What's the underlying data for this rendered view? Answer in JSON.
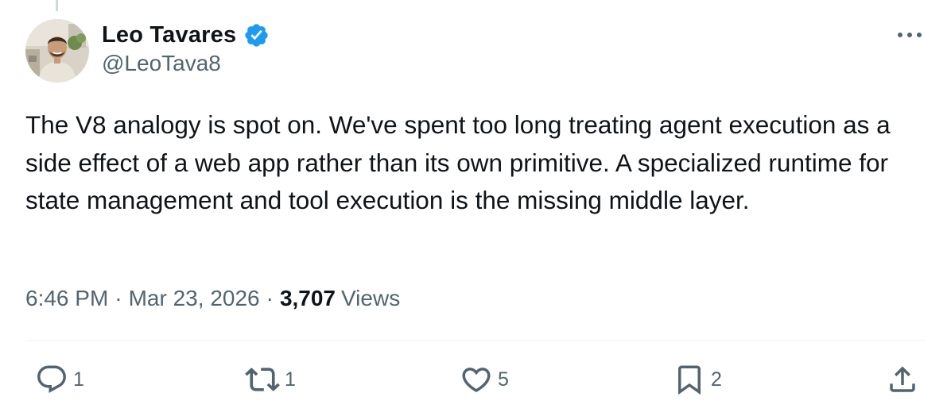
{
  "author": {
    "name": "Leo Tavares",
    "handle": "@LeoTava8",
    "verified": true,
    "verified_color": "#1d9bf0"
  },
  "tweet": {
    "text": "The V8 analogy is spot on. We've spent too long treating agent execution as a side effect of a web app rather than its own primitive. A specialized runtime for state management and tool execution is the missing middle layer.",
    "time": "6:46 PM",
    "separator": "·",
    "date": "Mar 23, 2026",
    "views_count": "3,707",
    "views_label": "Views"
  },
  "actions": {
    "replies": "1",
    "reposts": "1",
    "likes": "5",
    "bookmarks": "2"
  },
  "icons": {
    "more": "more-horizontal-icon",
    "reply": "reply-icon",
    "repost": "repost-icon",
    "like": "heart-icon",
    "bookmark": "bookmark-icon",
    "share": "share-icon",
    "verified": "verified-badge-icon"
  },
  "colors": {
    "text_primary": "#0f1419",
    "text_secondary": "#536471",
    "divider": "#eff3f4",
    "accent": "#1d9bf0"
  }
}
